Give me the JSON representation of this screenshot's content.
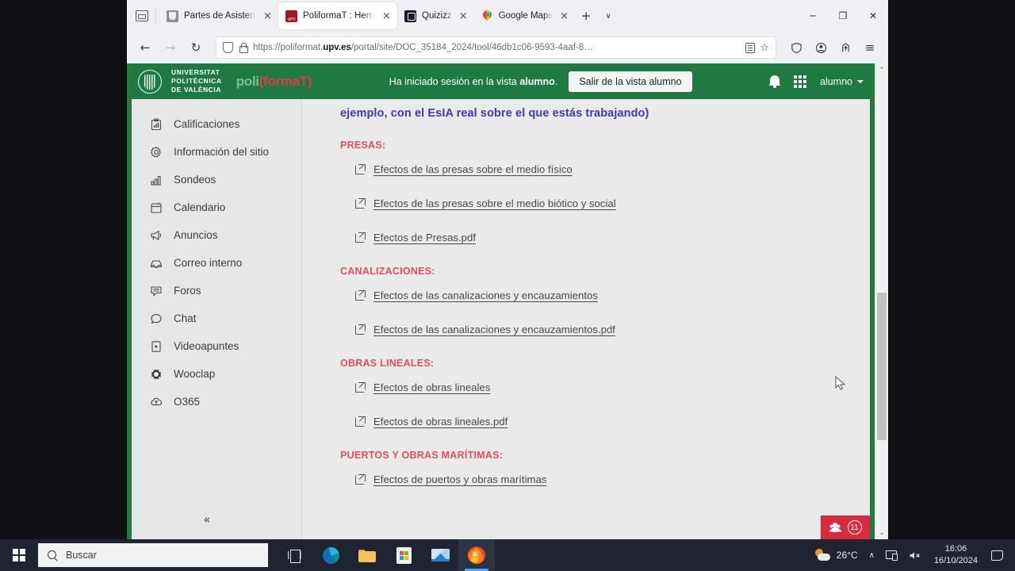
{
  "browser": {
    "toolbar": {
      "firefox_view": "firefox-view",
      "list_tabs": "∨",
      "new_tab": "+"
    },
    "tabs": [
      {
        "title": "Partes de Asistencia - E",
        "favicon": "upv-seal-icon",
        "active": false,
        "close": "×"
      },
      {
        "title": "PoliformaT : Herramien",
        "favicon": "poliformat-icon",
        "active": true,
        "close": "×"
      },
      {
        "title": "Quizizz",
        "favicon": "quizizz-icon",
        "active": false,
        "close": "×"
      },
      {
        "title": "Google Maps",
        "favicon": "google-maps-icon",
        "active": false,
        "close": "×"
      }
    ],
    "window_controls": {
      "minimize": "─",
      "maximize": "❐",
      "close": "✕"
    },
    "nav": {
      "back": "←",
      "forward": "→",
      "reload": "↻",
      "menu": "≡"
    },
    "url": {
      "prefix": "https://poliformat.",
      "domain": "upv.es",
      "suffix": "/portal/site/DOC_35184_2024/tool/46db1c06-9593-4aaf-8…"
    },
    "star": "☆"
  },
  "appheader": {
    "university": "UNIVERSITAT\nPOLITÈCNICA\nDE VALÈNCIA",
    "university_line1": "UNIVERSITAT",
    "university_line2": "POLITÈCNICA",
    "university_line3": "DE VALÈNCIA",
    "logo_part1": "poli",
    "logo_part2": "(formaT)",
    "view_message_pre": "Ha iniciado sesión en la vista ",
    "view_message_role": "alumno",
    "view_message_post": ".",
    "exit_view_button": "Salir de la vista alumno",
    "username": "alumno",
    "brand_green": "#1e7a41",
    "brand_red": "#e03b4e"
  },
  "sidebar": {
    "items": [
      {
        "label": "Calificaciones",
        "icon": "grades-icon"
      },
      {
        "label": "Información del sitio",
        "icon": "gear-icon"
      },
      {
        "label": "Sondeos",
        "icon": "bar-chart-icon"
      },
      {
        "label": "Calendario",
        "icon": "calendar-icon"
      },
      {
        "label": "Anuncios",
        "icon": "megaphone-icon"
      },
      {
        "label": "Correo interno",
        "icon": "inbox-icon"
      },
      {
        "label": "Foros",
        "icon": "forum-icon"
      },
      {
        "label": "Chat",
        "icon": "chat-bubble-icon"
      },
      {
        "label": "Videoapuntes",
        "icon": "video-file-icon"
      },
      {
        "label": "Wooclap",
        "icon": "wooclap-icon"
      },
      {
        "label": "O365",
        "icon": "cloud-upload-icon"
      }
    ],
    "collapse_label": "«"
  },
  "content": {
    "intro_line": "ejemplo, con el EsIA real sobre el que estás trabajando)",
    "sections": [
      {
        "heading": "PRESAS:",
        "links": [
          "Efectos de las presas sobre el medio físico",
          "Efectos de las presas sobre el medio biótico y social",
          "Efectos de Presas.pdf"
        ]
      },
      {
        "heading": "CANALIZACIONES:",
        "links": [
          "Efectos de las canalizaciones y encauzamientos",
          "Efectos de las canalizaciones y encauzamientos.pdf"
        ]
      },
      {
        "heading": "OBRAS LINEALES:",
        "links": [
          "Efectos de obras lineales",
          "Efectos de obras lineales.pdf"
        ]
      },
      {
        "heading": "PUERTOS Y OBRAS MARÍTIMAS:",
        "links": [
          "Efectos de puertos y obras marítimas"
        ]
      }
    ],
    "heading_color": "#e05060",
    "intro_color": "#3b3bb0"
  },
  "chat_widget": {
    "icon": "people-icon",
    "count": "11",
    "color": "#d92b3f"
  },
  "scrollbar": {
    "up": "⌃",
    "down": "⌄"
  },
  "taskbar": {
    "start": "windows-logo-icon",
    "search_placeholder": "Buscar",
    "task_view": "task-view-icon",
    "apps": [
      {
        "name": "microsoft-edge-icon"
      },
      {
        "name": "file-explorer-icon"
      },
      {
        "name": "microsoft-store-icon"
      },
      {
        "name": "mail-icon"
      },
      {
        "name": "firefox-icon",
        "active": true
      }
    ],
    "tray": {
      "weather_temp": "26°C",
      "chevron": "∧",
      "network": "network-icon",
      "volume": "⧸",
      "time": "16:06",
      "date": "16/10/2024",
      "notifications": "notification-icon"
    }
  }
}
